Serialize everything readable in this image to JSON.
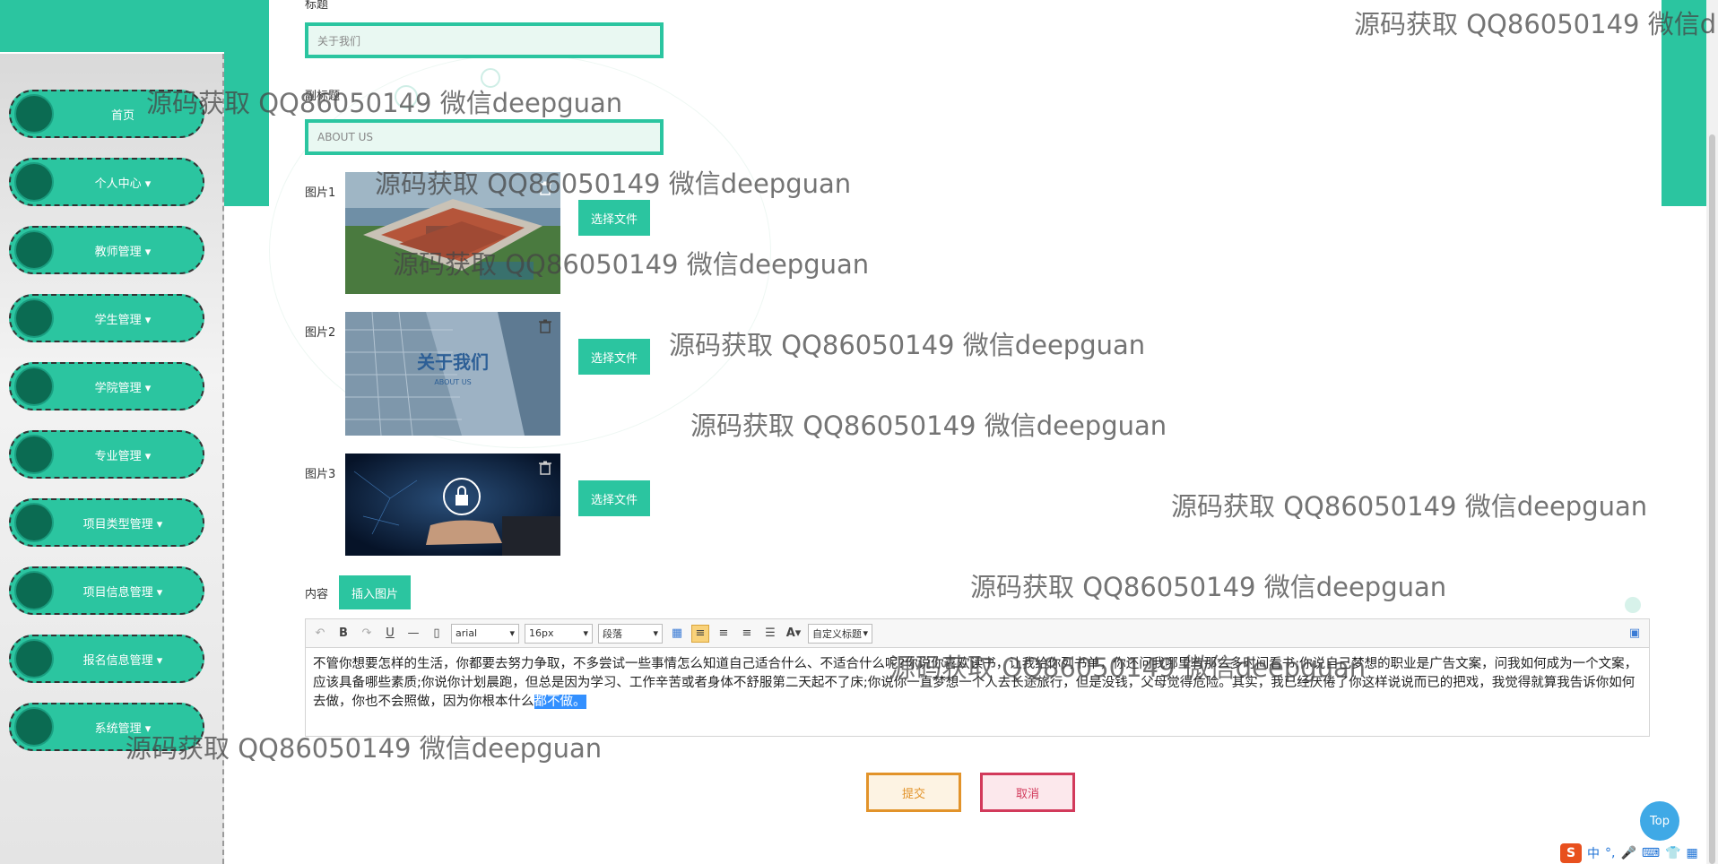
{
  "sidebar": {
    "items": [
      {
        "label": "首页"
      },
      {
        "label": "个人中心 ▾"
      },
      {
        "label": "教师管理 ▾"
      },
      {
        "label": "学生管理 ▾"
      },
      {
        "label": "学院管理 ▾"
      },
      {
        "label": "专业管理 ▾"
      },
      {
        "label": "项目类型管理 ▾"
      },
      {
        "label": "项目信息管理 ▾"
      },
      {
        "label": "报名信息管理 ▾"
      },
      {
        "label": "系统管理 ▾"
      }
    ]
  },
  "form": {
    "title_label": "标题",
    "title_value": "关于我们",
    "subtitle_label": "副标题",
    "subtitle_value": "ABOUT US",
    "images": [
      {
        "label": "图片1",
        "button": "选择文件"
      },
      {
        "label": "图片2",
        "button": "选择文件",
        "overlay_title": "关于我们",
        "overlay_sub": "ABOUT US"
      },
      {
        "label": "图片3",
        "button": "选择文件"
      }
    ],
    "content_label": "内容",
    "insert_image_button": "插入图片",
    "submit_button": "提交",
    "cancel_button": "取消"
  },
  "editor": {
    "toolbar": {
      "font_family": "arial",
      "font_size": "16px",
      "paragraph": "段落",
      "custom_heading": "自定义标题"
    },
    "content_main": "不管你想要怎样的生活，你都要去努力争取，不多尝试一些事情怎么知道自己适合什么、不适合什么呢?你说你喜欢读书，让我给你列书单，你还问我哪里有那么多时间看书;你说自己梦想的职业是广告文案，问我如何成为一个文案，应该具备哪些素质;你说你计划晨跑，但总是因为学习、工作辛苦或者身体不舒服第二天起不了床;你说你一直梦想一个人去长途旅行，但是没钱，父母觉得危险。其实，我已经厌倦了你这样说说而已的把戏，我觉得就算我告诉你如何去做，你也不会照做，因为你根本什么",
    "content_selected": "都不做。"
  },
  "top_button": "Top",
  "watermark_text": "源码获取 QQ86050149 微信deepguan",
  "watermark_text_cut": "源码获取 QQ86050149 微信d",
  "tray": {
    "logo": "S",
    "ime": "中"
  }
}
